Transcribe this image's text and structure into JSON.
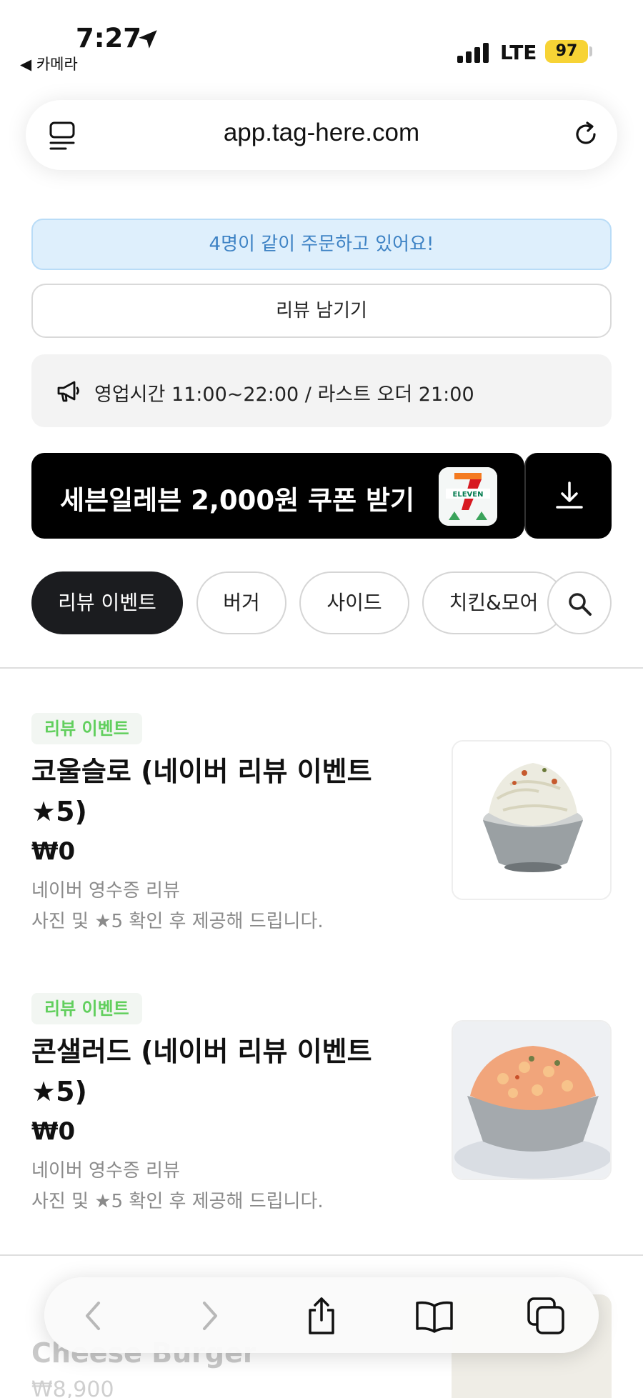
{
  "status_bar": {
    "time": "7:27",
    "back_label": "◀ 카메라",
    "network": "LTE",
    "battery": "97",
    "battery_color": "#f7d335"
  },
  "address_bar": {
    "url": "app.tag-here.com",
    "menu_icon": "page-menu-icon",
    "reload_icon": "reload-icon"
  },
  "notices": {
    "together": "4명이 같이 주문하고 있어요!",
    "review_button": "리뷰 남기기",
    "hours": "영업시간 11:00~22:00 / 라스트 오더 21:00"
  },
  "coupon": {
    "text": "세븐일레븐 2,000원 쿠폰 받기",
    "logo_text": "ELEVEN",
    "logo_number": "7"
  },
  "categories": {
    "chips": [
      "리뷰 이벤트",
      "버거",
      "사이드",
      "치킨&모어"
    ],
    "active": "리뷰 이벤트"
  },
  "menu": {
    "items": [
      {
        "badge": "리뷰 이벤트",
        "name": "코울슬로 (네이버 리뷰 이벤트 ★5)",
        "price": "₩0",
        "desc_line1": "네이버 영수증 리뷰",
        "desc_line2": "사진 및 ★5 확인 후 제공해 드립니다."
      },
      {
        "badge": "리뷰 이벤트",
        "name": "콘샐러드 (네이버 리뷰 이벤트 ★5)",
        "price": "₩0",
        "desc_line1": "네이버 영수증 리뷰",
        "desc_line2": "사진 및 ★5 확인 후 제공해 드립니다."
      }
    ],
    "next_item": {
      "name": "Cheese Burger",
      "price": "₩8,900"
    }
  },
  "colors": {
    "badge_green": "#61cf5d",
    "notice_blue": "#3d82c4",
    "chip_active": "#1b1c1f"
  }
}
